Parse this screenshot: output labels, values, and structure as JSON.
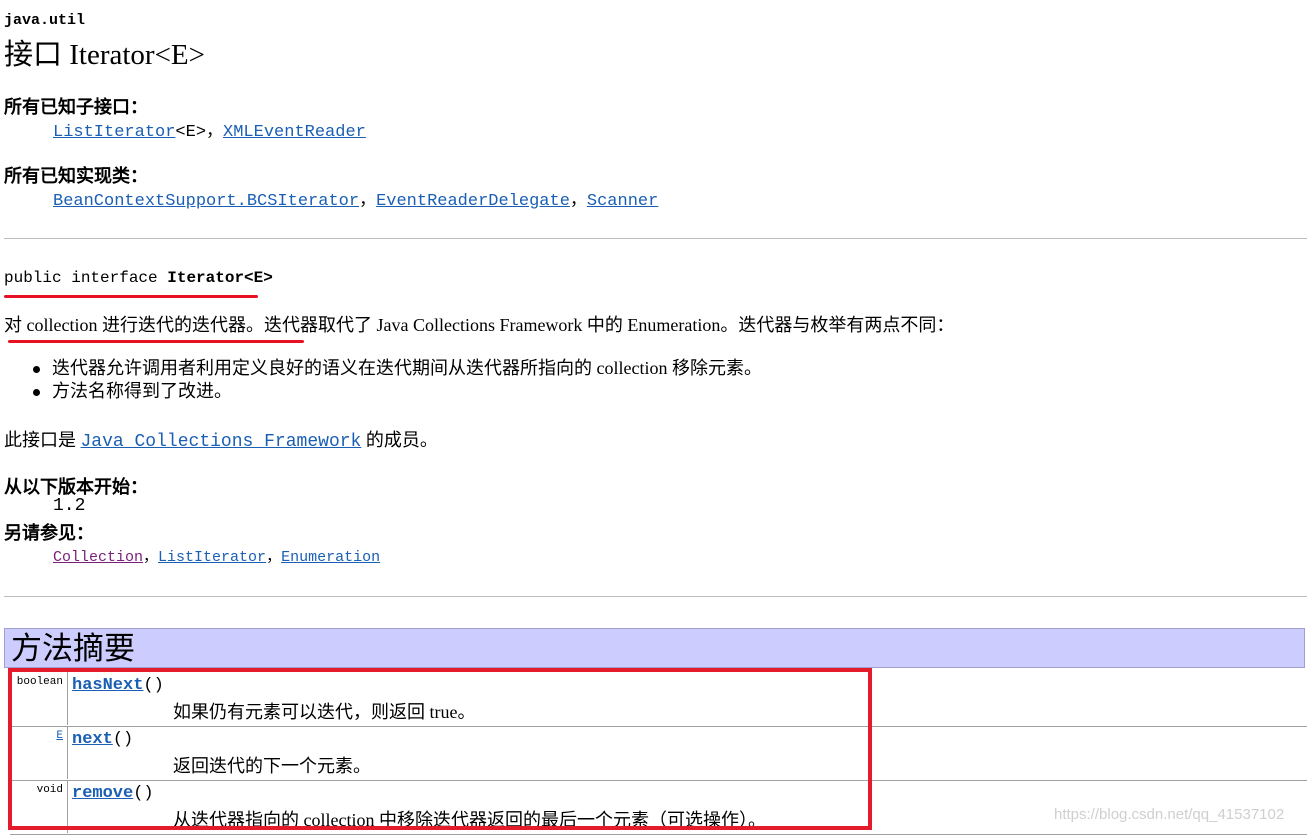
{
  "package": "java.util",
  "title": "接口 Iterator<E>",
  "subinterfaces": {
    "label": "所有已知子接口：",
    "items": [
      {
        "name": "ListIterator",
        "suffix": "<E>"
      },
      {
        "name": "XMLEventReader",
        "suffix": ""
      }
    ],
    "separator": "，"
  },
  "implementing": {
    "label": "所有已知实现类：",
    "items": [
      "BeanContextSupport.BCSIterator",
      "EventReaderDelegate",
      "Scanner"
    ],
    "separator": "，"
  },
  "declaration": {
    "prefix": "public interface ",
    "name": "Iterator<E>"
  },
  "description": {
    "text": "对 collection 进行迭代的迭代器。迭代器取代了 Java Collections Framework 中的 Enumeration。迭代器与枚举有两点不同：",
    "bullets": [
      "迭代器允许调用者利用定义良好的语义在迭代期间从迭代器所指向的 collection 移除元素。",
      "方法名称得到了改进。"
    ]
  },
  "member": {
    "prefix": "此接口是 ",
    "link": "Java Collections Framework",
    "suffix": " 的成员。"
  },
  "since": {
    "label": "从以下版本开始：",
    "value": "1.2"
  },
  "see_also": {
    "label": "另请参见：",
    "items": [
      "Collection",
      "ListIterator",
      "Enumeration"
    ],
    "separator": "，"
  },
  "method_summary": {
    "title": "方法摘要",
    "rows": [
      {
        "type": "boolean",
        "name": "hasNext",
        "params": "()",
        "desc": "如果仍有元素可以迭代，则返回 true。"
      },
      {
        "type": "E",
        "name": "next",
        "params": "()",
        "desc": "返回迭代的下一个元素。"
      },
      {
        "type": "void",
        "name": "remove",
        "params": "()",
        "desc": "从迭代器指向的 collection 中移除迭代器返回的最后一个元素（可选操作）。"
      }
    ]
  },
  "watermark": "https://blog.csdn.net/qq_41537102",
  "colors": {
    "link": "#1a5fb4",
    "visited_link": "#7a1f7a",
    "summary_header_bg": "#ccccff",
    "annotation_red": "#e31b2b"
  }
}
